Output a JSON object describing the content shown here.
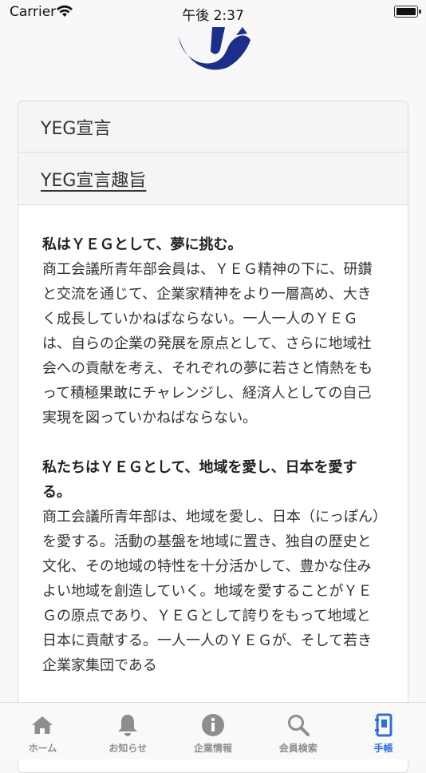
{
  "status_bar": {
    "carrier": "Carrier",
    "time": "午後 2:37"
  },
  "colors": {
    "logo": "#1d2d8a",
    "tab_active": "#2f6fd6",
    "tab_inactive": "#8e8e8e"
  },
  "header": {
    "title": "YEG宣言",
    "subtitle": "YEG宣言趣旨"
  },
  "sections": [
    {
      "title": "私はＹＥＧとして、夢に挑む。",
      "body": "商工会議所青年部会員は、ＹＥＧ精神の下に、研鑽と交流を通じて、企業家精神をより一層高め、大きく成長していかねばならない。一人一人のＹＥＧは、自らの企業の発展を原点として、さらに地域社会への貢献を考え、それぞれの夢に若さと情熱をもって積極果敢にチャレンジし、経済人としての自己実現を図っていかねばならない。"
    },
    {
      "title": "私たちはＹＥＧとして、地域を愛し、日本を愛する。",
      "body": "商工会議所青年部は、地域を愛し、日本（にっぽん）を愛する。活動の基盤を地域に置き、独自の歴史と文化、その地域の特性を十分活かして、豊かな住みよい地域を創造していく。地域を愛することがＹＥＧの原点であり、ＹＥＧとして誇りをもって地域と日本に貢献する。一人一人のＹＥＧが、そして若き企業家集団である"
    }
  ],
  "tabs": [
    {
      "label": "ホーム",
      "icon": "home-icon"
    },
    {
      "label": "お知らせ",
      "icon": "bell-icon"
    },
    {
      "label": "企業情報",
      "icon": "info-icon"
    },
    {
      "label": "会員検索",
      "icon": "search-icon"
    },
    {
      "label": "手帳",
      "icon": "notebook-icon",
      "active": true
    }
  ]
}
